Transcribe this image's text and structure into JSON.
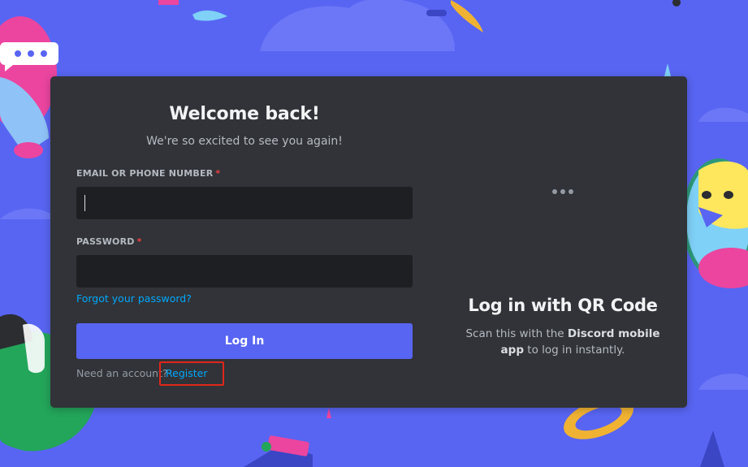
{
  "login": {
    "title": "Welcome back!",
    "subtitle": "We're so excited to see you again!",
    "email_label": "EMAIL OR PHONE NUMBER",
    "password_label": "PASSWORD",
    "required_mark": "*",
    "email_value": "",
    "password_value": "",
    "forgot_link": "Forgot your password?",
    "login_button": "Log In",
    "need_account": "Need an account?",
    "register_link": "Register"
  },
  "qr": {
    "title": "Log in with QR Code",
    "desc_prefix": "Scan this with the ",
    "desc_bold": "Discord mobile app",
    "desc_suffix": " to log in instantly."
  },
  "colors": {
    "background": "#5865f2",
    "card": "#313338",
    "input": "#1e1f22",
    "link": "#00a8fc",
    "button": "#5865f2",
    "highlight": "#e0261b"
  }
}
